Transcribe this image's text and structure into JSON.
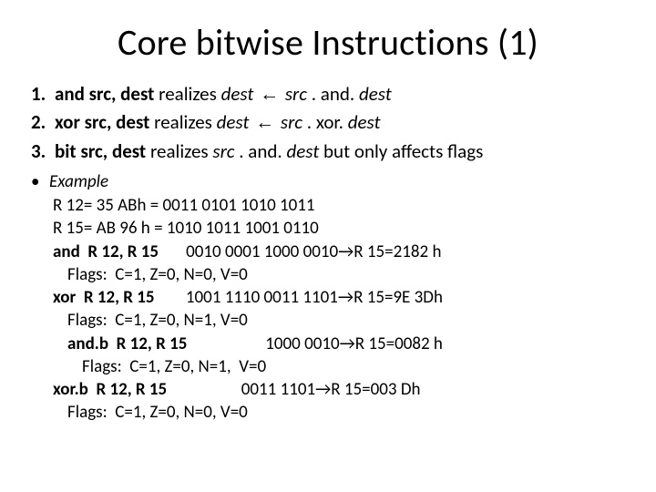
{
  "title": "Core bitwise Instructions (1)",
  "list": {
    "n1": "1.",
    "n2": "2.",
    "n3": "3.",
    "item1_mn": "and  src, dest",
    "item1_mid": "   realizes   ",
    "item1_dest": "dest ",
    "item1_arrow": "←",
    "item1_tail1": " src ",
    "item1_tail2": ". and. ",
    "item1_tail3": "dest",
    "item2_mn": "xor  src, dest",
    "item2_mid": "   realizes   ",
    "item2_dest": "dest ",
    "item2_arrow": "←",
    "item2_tail1": " src ",
    "item2_tail2": ". xor. ",
    "item2_tail3": "dest",
    "item3_mn": "bit  src, dest",
    "item3_mid": "   realizes   ",
    "item3_tail1": "src ",
    "item3_tail2": ". and. ",
    "item3_tail3": "dest",
    "item3_tail4": "  but only affects flags"
  },
  "bullet": "•",
  "example_label": "Example",
  "ex": {
    "l1": "R 12= 35 ABh = 0011 0101 1010 1011",
    "l2": "R 15= AB 96 h = 1010 1011 1001 0110",
    "l3a": "and  R 12, R 15",
    "l3b": "       0010 0001 1000 0010→R 15=2182 h",
    "l4": "Flags:  C=1, Z=0, N=0, V=0",
    "l5a": "xor  R 12, R 15",
    "l5b": "        1001 1110 0011 1101→R 15=9E 3Dh",
    "l6": "Flags:  C=1, Z=0, N=1, V=0",
    "l7a": "and.b  R 12, R 15",
    "l7b": "                    1000 0010→R 15=0082 h",
    "l8": "Flags:  C=1, Z=0, N=1,  V=0",
    "l9a": "xor.b  R 12, R 15",
    "l9b": "                   0011 1101→R 15=003 Dh",
    "l10": "Flags:  C=1, Z=0, N=0, V=0"
  }
}
